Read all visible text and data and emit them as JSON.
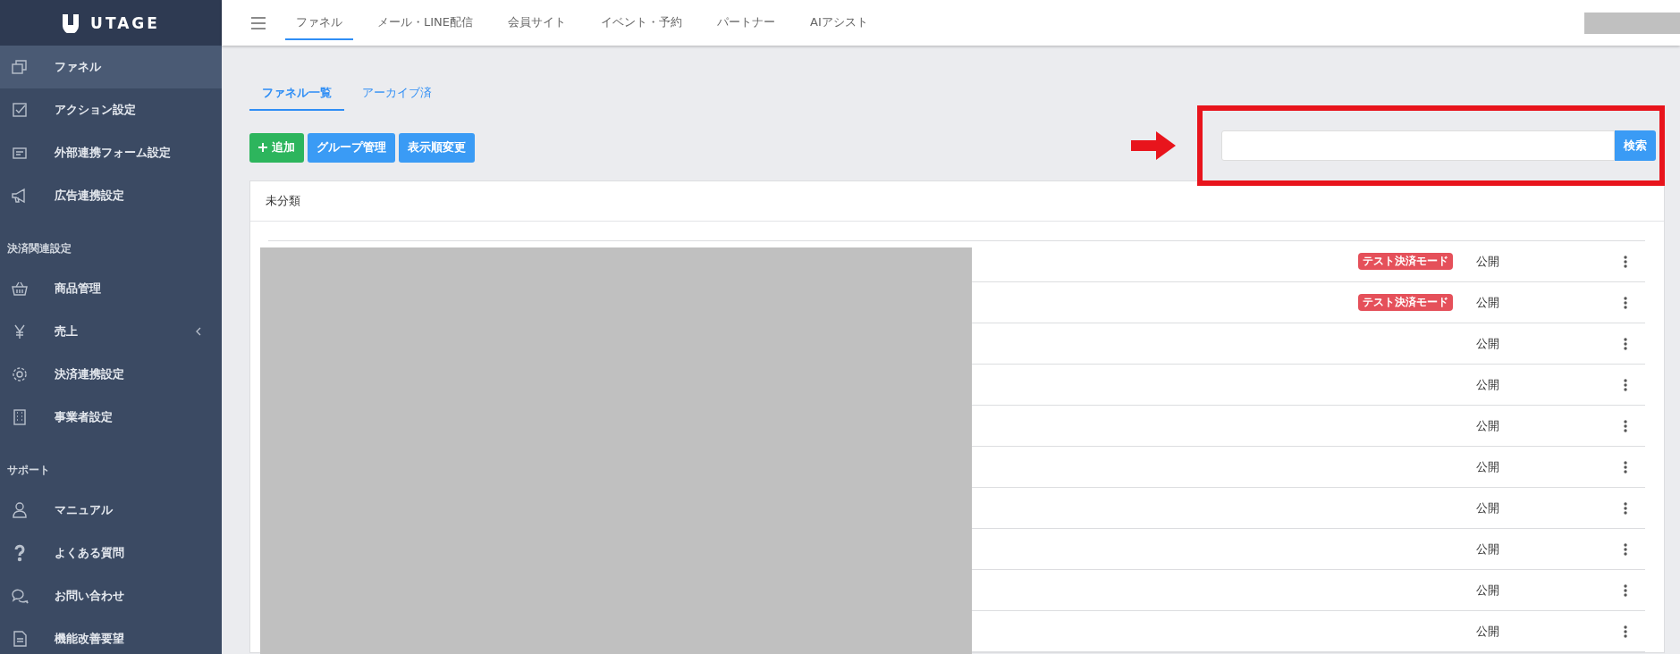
{
  "sidebar": {
    "logo": "UTAGE",
    "sections": [
      {
        "items": [
          {
            "label": "ファネル",
            "selected": true
          },
          {
            "label": "アクション設定",
            "selected": false
          },
          {
            "label": "外部連携フォーム設定",
            "selected": false
          },
          {
            "label": "広告連携設定",
            "selected": false
          }
        ]
      },
      {
        "heading": "決済関連設定",
        "items": [
          {
            "label": "商品管理",
            "selected": false
          },
          {
            "label": "売上",
            "selected": false,
            "expanded": false
          },
          {
            "label": "決済連携設定",
            "selected": false
          },
          {
            "label": "事業者設定",
            "selected": false
          }
        ]
      },
      {
        "heading": "サポート",
        "items": [
          {
            "label": "マニュアル",
            "selected": false
          },
          {
            "label": "よくある質問",
            "selected": false
          },
          {
            "label": "お問い合わせ",
            "selected": false
          },
          {
            "label": "機能改善要望",
            "selected": false
          }
        ]
      }
    ]
  },
  "top_nav": {
    "tabs": [
      {
        "label": "ファネル",
        "selected": true
      },
      {
        "label": "メール・LINE配信",
        "selected": false
      },
      {
        "label": "会員サイト",
        "selected": false
      },
      {
        "label": "イベント・予約",
        "selected": false
      },
      {
        "label": "パートナー",
        "selected": false
      },
      {
        "label": "AIアシスト",
        "selected": false
      }
    ]
  },
  "page_tabs": [
    {
      "label": "ファネル一覧",
      "selected": true
    },
    {
      "label": "アーカイブ済",
      "selected": false
    }
  ],
  "toolbar": {
    "buttons": [
      {
        "label": "追加",
        "kind": "add"
      },
      {
        "label": "グループ管理",
        "kind": "plain"
      },
      {
        "label": "表示順変更",
        "kind": "plain"
      }
    ]
  },
  "search": {
    "button": "検索"
  },
  "group": {
    "title": "未分類",
    "rows": [
      {
        "badge": "テスト決済モード",
        "status": "公開"
      },
      {
        "badge": "テスト決済モード",
        "status": "公開"
      },
      {
        "status": "公開"
      },
      {
        "status": "公開"
      },
      {
        "status": "公開"
      },
      {
        "status": "公開"
      },
      {
        "status": "公開"
      },
      {
        "status": "公開"
      },
      {
        "status": "公開"
      },
      {
        "status": "公開"
      }
    ]
  }
}
